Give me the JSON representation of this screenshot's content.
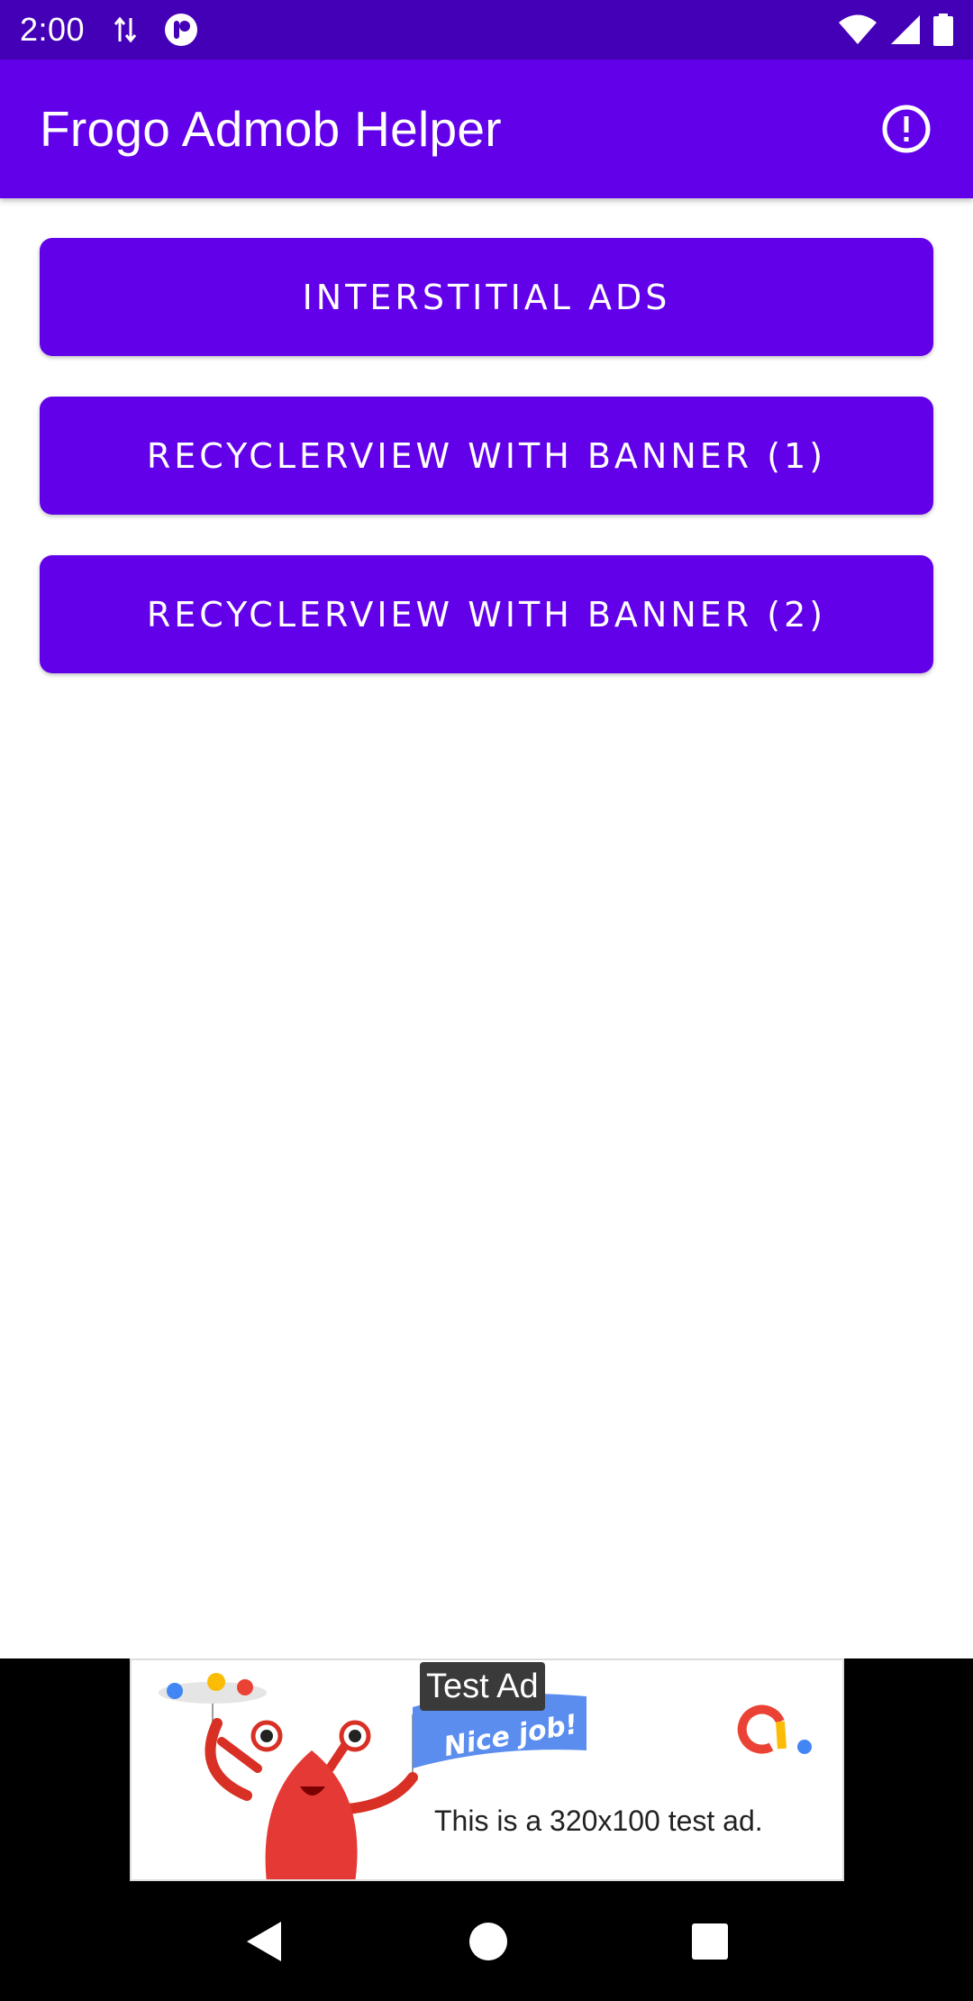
{
  "status_bar": {
    "time": "2:00",
    "icons": [
      "data-transfer-icon",
      "app-notification-icon",
      "wifi-icon",
      "cell-signal-icon",
      "battery-icon"
    ]
  },
  "app_bar": {
    "title": "Frogo Admob Helper",
    "info_icon": "info-circle-icon"
  },
  "buttons": [
    {
      "label": "INTERSTITIAL ADS"
    },
    {
      "label": "RECYCLERVIEW WITH BANNER (1)"
    },
    {
      "label": "RECYCLERVIEW WITH BANNER (2)"
    }
  ],
  "ad": {
    "label": "Test Ad",
    "flag_text": "Nice job!",
    "text": "This is a 320x100 test ad."
  },
  "nav_bar": {
    "icons": [
      "back-icon",
      "home-icon",
      "recents-icon"
    ]
  },
  "colors": {
    "primary": "#6200ea",
    "primary_dark": "#4400b6",
    "background": "#ffffff"
  }
}
